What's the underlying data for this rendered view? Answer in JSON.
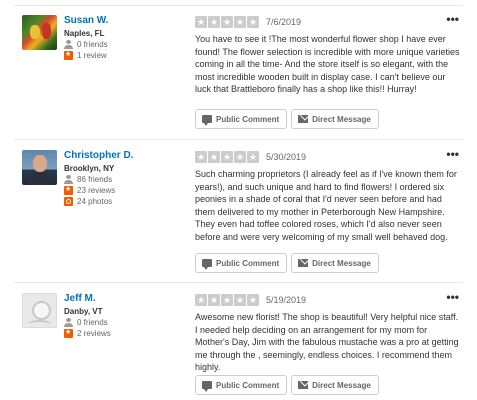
{
  "reviews": [
    {
      "user": {
        "name": "Susan W.",
        "location": "Naples, FL",
        "friends": "0 friends",
        "reviews": "1 review",
        "photos": ""
      },
      "rating": 5,
      "date": "7/6/2019",
      "text": "You have to see it !The most wonderful flower shop I have ever found!   The flower selection is incredible with more unique varieties coming in all the time- And the store itself is so elegant, with the most incredible wooden built in display case. I can't believe our luck that Brattleboro finally has a shop like this!! Hurray!"
    },
    {
      "user": {
        "name": "Christopher D.",
        "location": "Brooklyn, NY",
        "friends": "86 friends",
        "reviews": "23 reviews",
        "photos": "24 photos"
      },
      "rating": 5,
      "date": "5/30/2019",
      "text": "Such charming proprietors (I already feel as if I've known them for years!), and such unique and hard to find flowers! I ordered six peonies in a shade of coral that I'd never seen before and had them delivered to my mother in Peterborough New Hampshire. They even had toffee colored roses, which I'd also never seen before and were very welcoming of my small well behaved dog."
    },
    {
      "user": {
        "name": "Jeff M.",
        "location": "Danby, VT",
        "friends": "0 friends",
        "reviews": "2 reviews",
        "photos": ""
      },
      "rating": 5,
      "date": "5/19/2019",
      "text": "Awesome new florist! The shop is beautiful! Very helpful nice staff. I needed help deciding on an arrangement for my mom for Mother's Day, Jim with the fabulous mustache was a pro at getting me through the , seemingly, endless choices. I recommend them highly."
    }
  ],
  "actions": {
    "public_comment": "Public Comment",
    "direct_message": "Direct Message"
  },
  "more_label": "•••",
  "icons": {
    "friends": "friends-icon",
    "reviews": "review-star-icon",
    "photos": "camera-icon",
    "comment": "speech-bubble-icon",
    "message": "envelope-icon",
    "star": "star-icon"
  },
  "colors": {
    "username": "#0073bb",
    "star_empty": "#cccccc",
    "stat_icon": "#f15c00"
  }
}
